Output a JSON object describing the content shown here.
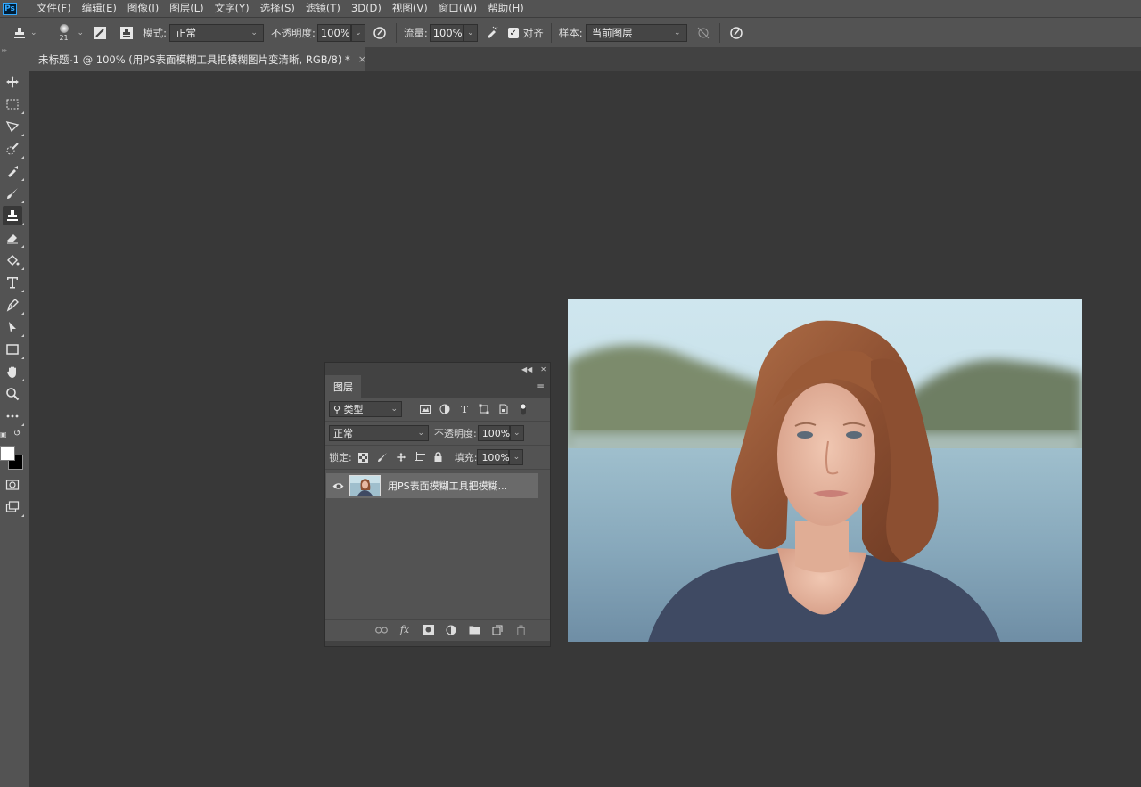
{
  "app": {
    "logo_text": "Ps"
  },
  "menu": [
    "文件(F)",
    "编辑(E)",
    "图像(I)",
    "图层(L)",
    "文字(Y)",
    "选择(S)",
    "滤镜(T)",
    "3D(D)",
    "视图(V)",
    "窗口(W)",
    "帮助(H)"
  ],
  "options": {
    "brush_size": "21",
    "mode_label": "模式:",
    "mode_value": "正常",
    "opacity_label": "不透明度:",
    "opacity_value": "100%",
    "flow_label": "流量:",
    "flow_value": "100%",
    "align_label": "对齐",
    "align_checked": true,
    "sample_label": "样本:",
    "sample_value": "当前图层"
  },
  "document_tab": {
    "title": "未标题-1 @ 100% (用PS表面模糊工具把模糊图片变清晰, RGB/8) *",
    "close": "×"
  },
  "colors": {
    "foreground": "#ffffff",
    "background": "#000000"
  },
  "layers_panel": {
    "tab_label": "图层",
    "filter_kind": "类型",
    "blend_mode": "正常",
    "opacity_label": "不透明度:",
    "opacity_value": "100%",
    "lock_label": "锁定:",
    "fill_label": "填充:",
    "fill_value": "100%",
    "layers": [
      {
        "name": "用PS表面模糊工具把模糊...",
        "visible": true
      }
    ],
    "footer_fx": "fx"
  },
  "icons": {
    "tools": [
      "move-icon",
      "marquee-icon",
      "lasso-icon",
      "quick-select-icon",
      "eyedropper-icon",
      "brush-icon",
      "clone-stamp-icon",
      "eraser-icon",
      "paint-bucket-icon",
      "type-icon",
      "pen-icon",
      "path-select-icon",
      "rectangle-icon",
      "hand-icon",
      "zoom-icon",
      "more-tools-icon"
    ]
  }
}
